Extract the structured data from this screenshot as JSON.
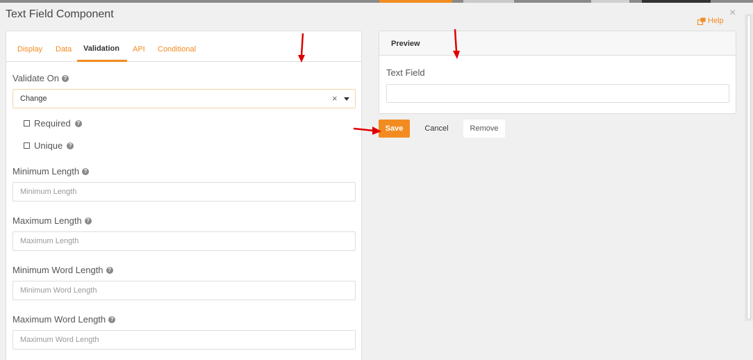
{
  "dialog": {
    "title": "Text Field Component",
    "help_label": "Help",
    "close_label": "×"
  },
  "tabs": [
    {
      "label": "Display"
    },
    {
      "label": "Data"
    },
    {
      "label": "Validation"
    },
    {
      "label": "API"
    },
    {
      "label": "Conditional"
    }
  ],
  "active_tab": "Validation",
  "validation": {
    "validate_on": {
      "label": "Validate On",
      "value": "Change",
      "clear": "×"
    },
    "required": {
      "label": "Required",
      "checked": false
    },
    "unique": {
      "label": "Unique",
      "checked": false
    },
    "minimum_length": {
      "label": "Minimum Length",
      "placeholder": "Minimum Length",
      "value": ""
    },
    "maximum_length": {
      "label": "Maximum Length",
      "placeholder": "Maximum Length",
      "value": ""
    },
    "minimum_word_length": {
      "label": "Minimum Word Length",
      "placeholder": "Minimum Word Length",
      "value": ""
    },
    "maximum_word_length": {
      "label": "Maximum Word Length",
      "placeholder": "Maximum Word Length",
      "value": ""
    }
  },
  "preview": {
    "heading": "Preview",
    "field_label": "Text Field",
    "field_value": ""
  },
  "actions": {
    "save": "Save",
    "cancel": "Cancel",
    "remove": "Remove"
  },
  "colors": {
    "accent": "#f28b20",
    "annotation": "#e00000"
  }
}
